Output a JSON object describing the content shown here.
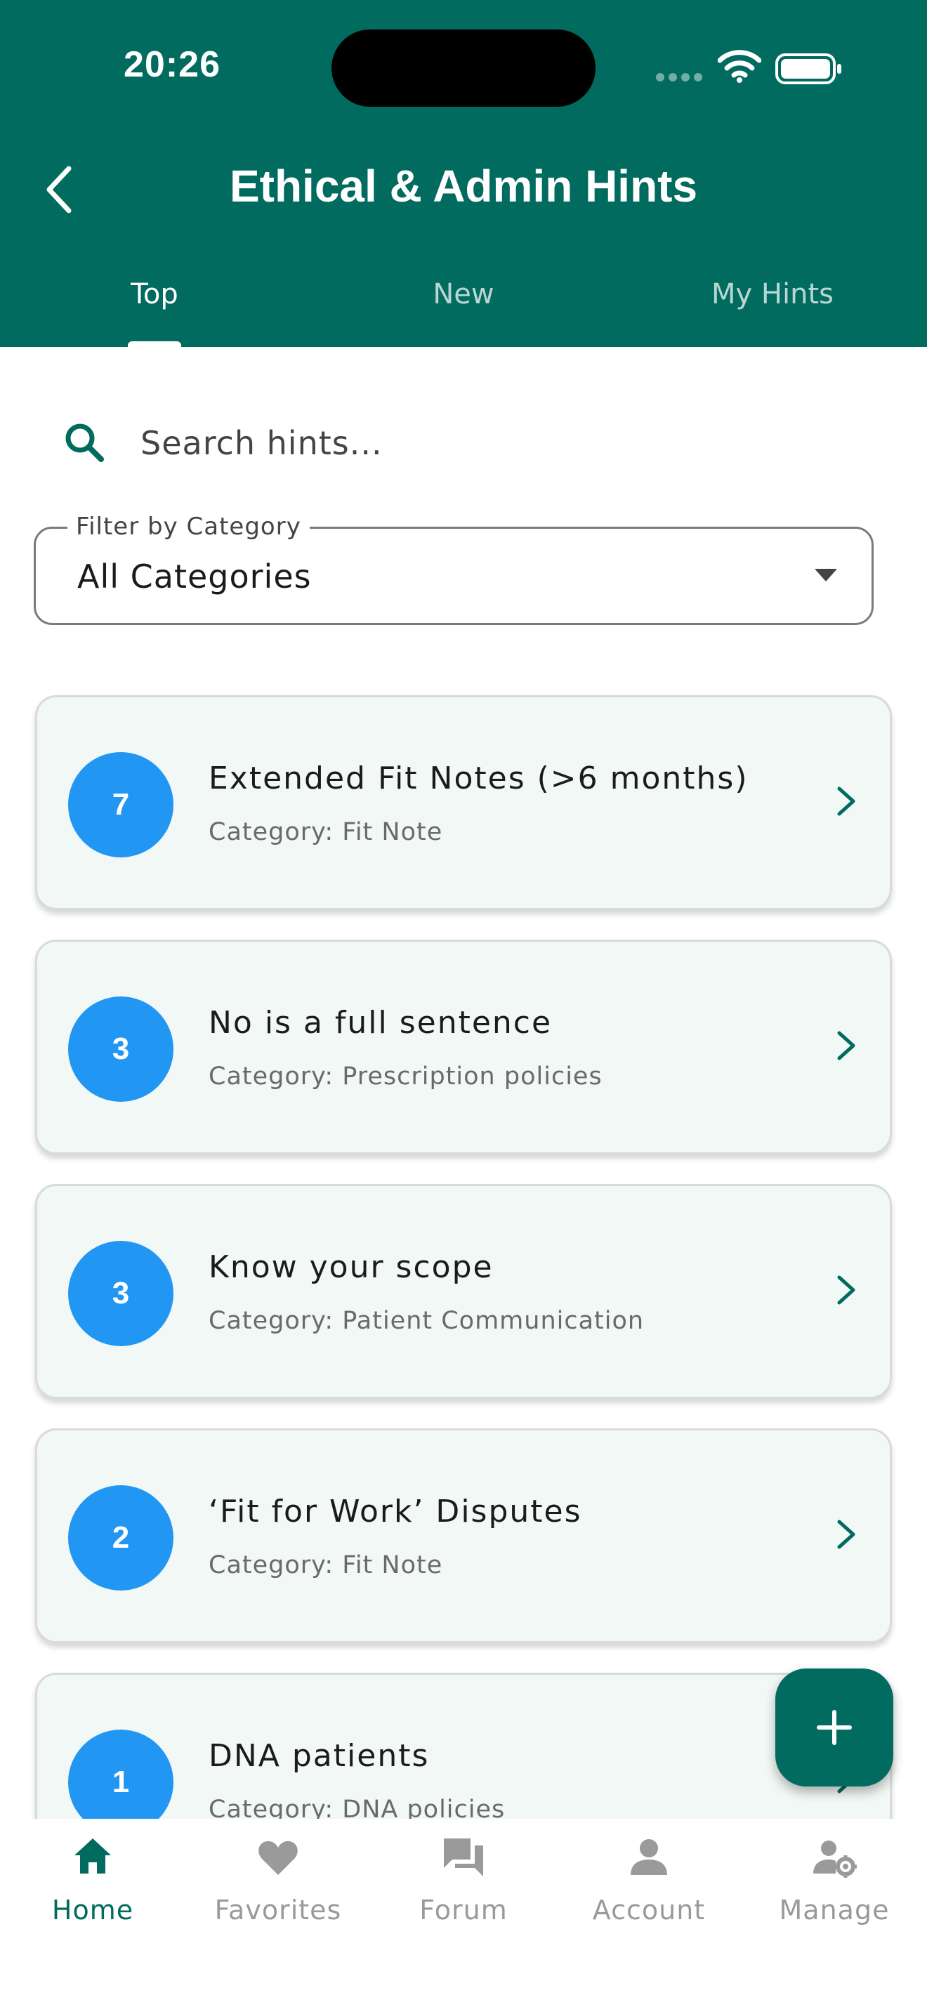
{
  "status_bar": {
    "time": "20:26"
  },
  "header": {
    "title": "Ethical & Admin Hints",
    "tabs": [
      {
        "label": "Top",
        "active": true
      },
      {
        "label": "New",
        "active": false
      },
      {
        "label": "My Hints",
        "active": false
      }
    ]
  },
  "search": {
    "placeholder": "Search hints...",
    "value": ""
  },
  "filter": {
    "label": "Filter by Category",
    "value": "All Categories"
  },
  "hints": [
    {
      "count": "7",
      "title": "Extended Fit Notes (>6 months)",
      "category": "Category: Fit Note"
    },
    {
      "count": "3",
      "title": "No is a full sentence",
      "category": "Category: Prescription policies"
    },
    {
      "count": "3",
      "title": "Know your scope",
      "category": "Category: Patient Communication"
    },
    {
      "count": "2",
      "title": "‘Fit for Work’ Disputes",
      "category": "Category: Fit Note"
    },
    {
      "count": "1",
      "title": "DNA patients",
      "category": "Category: DNA policies"
    }
  ],
  "bottom_nav": [
    {
      "label": "Home",
      "icon": "home-icon",
      "active": true
    },
    {
      "label": "Favorites",
      "icon": "heart-icon",
      "active": false
    },
    {
      "label": "Forum",
      "icon": "forum-icon",
      "active": false
    },
    {
      "label": "Account",
      "icon": "person-icon",
      "active": false
    },
    {
      "label": "Manage",
      "icon": "manage-icon",
      "active": false
    }
  ],
  "colors": {
    "primary": "#006b5e",
    "badge": "#2196f3",
    "card_bg": "#f2f8f6"
  }
}
